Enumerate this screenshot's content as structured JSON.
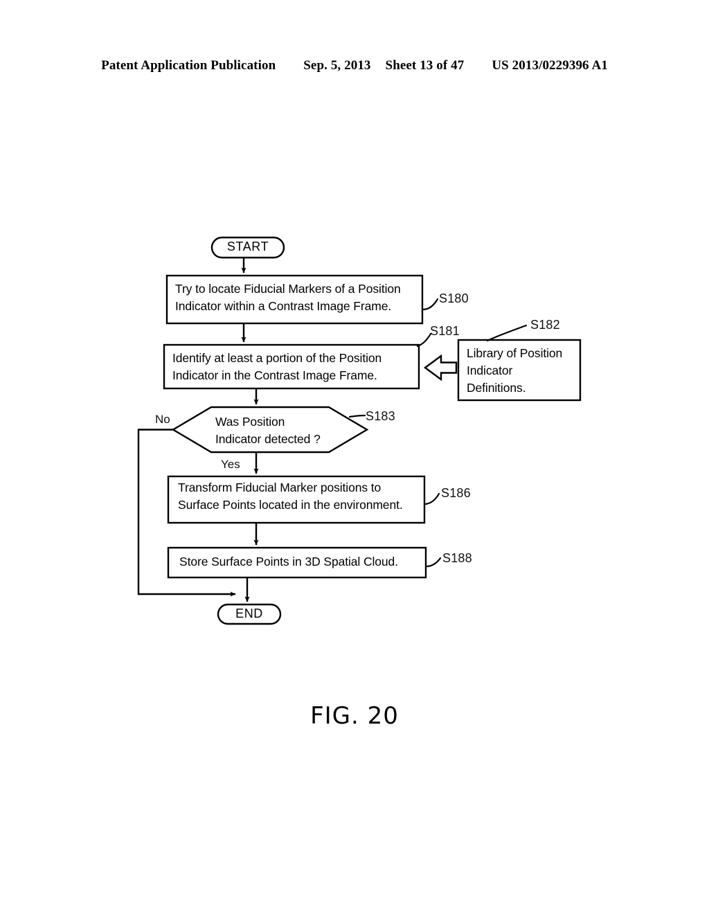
{
  "header": {
    "publication": "Patent Application Publication",
    "date": "Sep. 5, 2013",
    "sheet": "Sheet 13 of 47",
    "patent_number": "US 2013/0229396 A1"
  },
  "figure": {
    "caption": "FIG. 20"
  },
  "flowchart": {
    "start": {
      "label": "START"
    },
    "end": {
      "label": "END"
    },
    "steps": [
      {
        "id": "s180",
        "ref": "S180",
        "text": "Try to locate Fiducial Markers of a Position\nIndicator within a Contrast Image Frame."
      },
      {
        "id": "s181",
        "ref": "S181",
        "text": "Identify at least a portion of the Position\nIndicator in the Contrast Image Frame."
      },
      {
        "id": "s182",
        "ref": "S182",
        "text": "Library of Position\nIndicator\nDefinitions."
      },
      {
        "id": "s183",
        "ref": "S183",
        "text": "Was Position\nIndicator detected ?"
      },
      {
        "id": "s186",
        "ref": "S186",
        "text": "Transform Fiducial Marker positions to\nSurface Points located in the environment."
      },
      {
        "id": "s188",
        "ref": "S188",
        "text": "Store Surface Points in 3D Spatial Cloud."
      }
    ],
    "branches": {
      "no": "No",
      "yes": "Yes"
    },
    "colors": {
      "ink": "#000000",
      "paper": "#ffffff"
    }
  }
}
